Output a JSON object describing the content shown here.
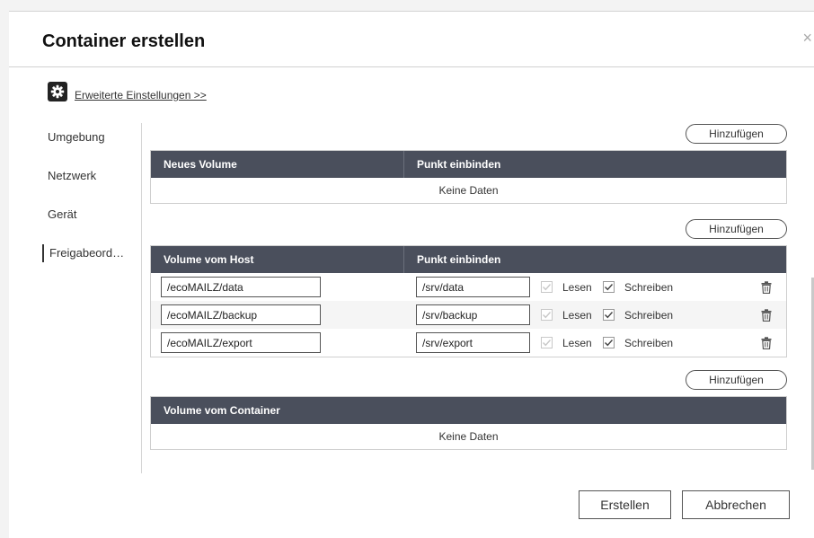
{
  "dialog": {
    "title": "Container erstellen",
    "close_glyph": "×",
    "advanced_link": "Erweiterte Einstellungen >>"
  },
  "sidenav": {
    "items": [
      {
        "label": "Umgebung"
      },
      {
        "label": "Netzwerk"
      },
      {
        "label": "Gerät"
      },
      {
        "label": "Freigabeord…",
        "active": true
      }
    ]
  },
  "new_volume": {
    "add_label": "Hinzufügen",
    "columns": [
      "Neues Volume",
      "Punkt einbinden"
    ],
    "empty_text": "Keine Daten"
  },
  "host_volume": {
    "add_label": "Hinzufügen",
    "columns": [
      "Volume vom Host",
      "Punkt einbinden"
    ],
    "read_label": "Lesen",
    "write_label": "Schreiben",
    "rows": [
      {
        "host": "/ecoMAILZ/data",
        "mount": "/srv/data",
        "read": true,
        "write": true
      },
      {
        "host": "/ecoMAILZ/backup",
        "mount": "/srv/backup",
        "read": true,
        "write": true
      },
      {
        "host": "/ecoMAILZ/export",
        "mount": "/srv/export",
        "read": true,
        "write": true
      }
    ]
  },
  "container_volume": {
    "add_label": "Hinzufügen",
    "columns": [
      "Volume vom Container"
    ],
    "empty_text": "Keine Daten"
  },
  "footer": {
    "create_label": "Erstellen",
    "cancel_label": "Abbrechen"
  },
  "icons": {
    "gear": "gear-icon",
    "trash": "trash-icon",
    "check": "check-icon"
  }
}
